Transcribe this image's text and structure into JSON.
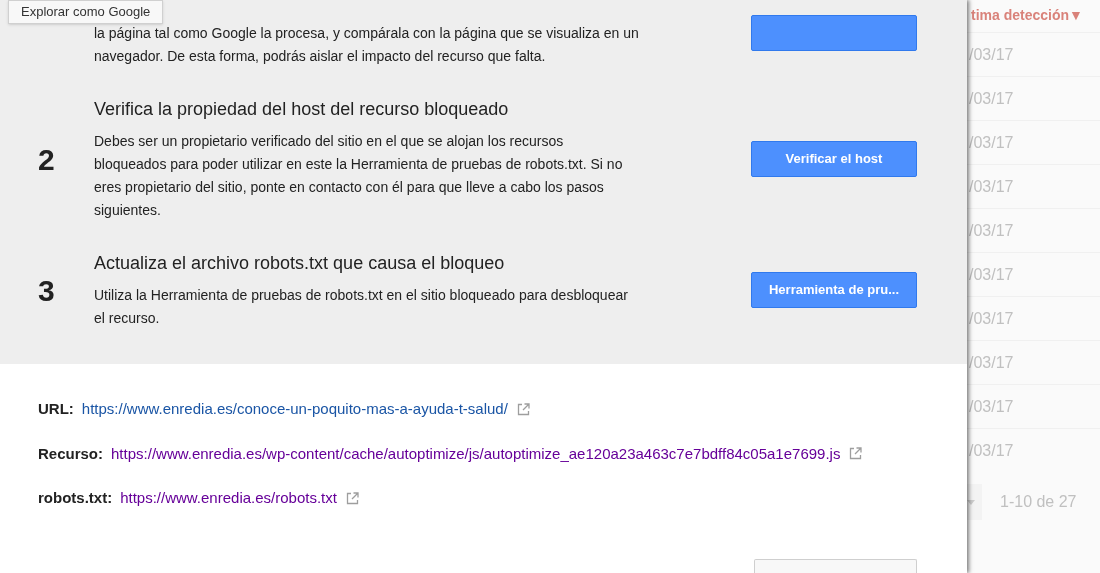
{
  "tooltip": "Explorar como Google",
  "steps": [
    {
      "text": "la página tal como Google la procesa, y compárala con la página que se visualiza en un navegador. De esta forma, podrás aislar el impacto del recurso que falta."
    },
    {
      "number": "2",
      "title": "Verifica la propiedad del host del recurso bloqueado",
      "text": "Debes ser un propietario verificado del sitio en el que se alojan los recursos bloqueados para poder utilizar en este la Herramienta de pruebas de robots.txt. Si no eres propietario del sitio, ponte en contacto con él para que lleve a cabo los pasos siguientes.",
      "button": "Verificar el host"
    },
    {
      "number": "3",
      "title": "Actualiza el archivo robots.txt que causa el bloqueo",
      "text": "Utiliza la Herramienta de pruebas de robots.txt en el sitio bloqueado para desbloquear el recurso.",
      "button": "Herramienta de pru..."
    }
  ],
  "details": [
    {
      "label": "URL:",
      "link": "https://www.enredia.es/conoce-un-poquito-mas-a-ayuda-t-salud/",
      "visited": false
    },
    {
      "label": "Recurso:",
      "link": "https://www.enredia.es/wp-content/cache/autoptimize/js/autoptimize_ae120a23a463c7e7bdff84c05a1e7699.js",
      "visited": true
    },
    {
      "label": "robots.txt:",
      "link": "https://www.enredia.es/robots.txt",
      "visited": true
    }
  ],
  "background_table": {
    "column_header": "tima detección▼",
    "rows": [
      "/03/17",
      "/03/17",
      "/03/17",
      "/03/17",
      "/03/17",
      "/03/17",
      "/03/17",
      "/03/17",
      "/03/17",
      "/03/17"
    ],
    "pagination": "1-10 de 27"
  }
}
